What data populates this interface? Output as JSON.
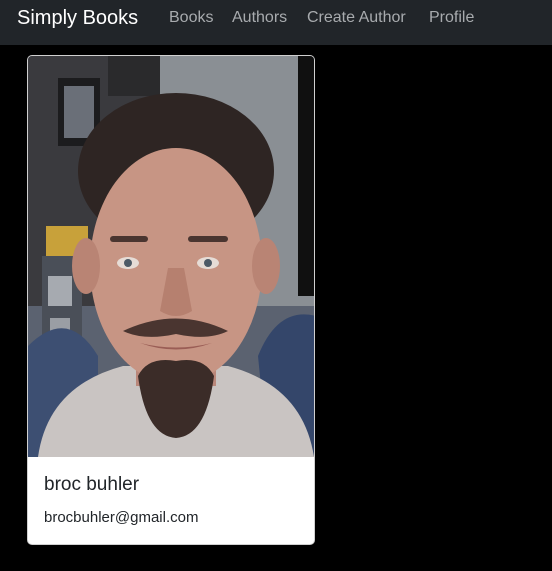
{
  "navbar": {
    "brand": "Simply Books",
    "links": [
      {
        "label": "Books"
      },
      {
        "label": "Authors"
      },
      {
        "label": "Create Author"
      },
      {
        "label": "Profile"
      }
    ]
  },
  "colors": {
    "page_background": "#000000",
    "navbar_background": "#212529",
    "nav_link": "#a8abae",
    "card_background": "#ffffff"
  },
  "author_card": {
    "photo": "author-photo",
    "name": "broc buhler",
    "email": "brocbuhler@gmail.com"
  }
}
